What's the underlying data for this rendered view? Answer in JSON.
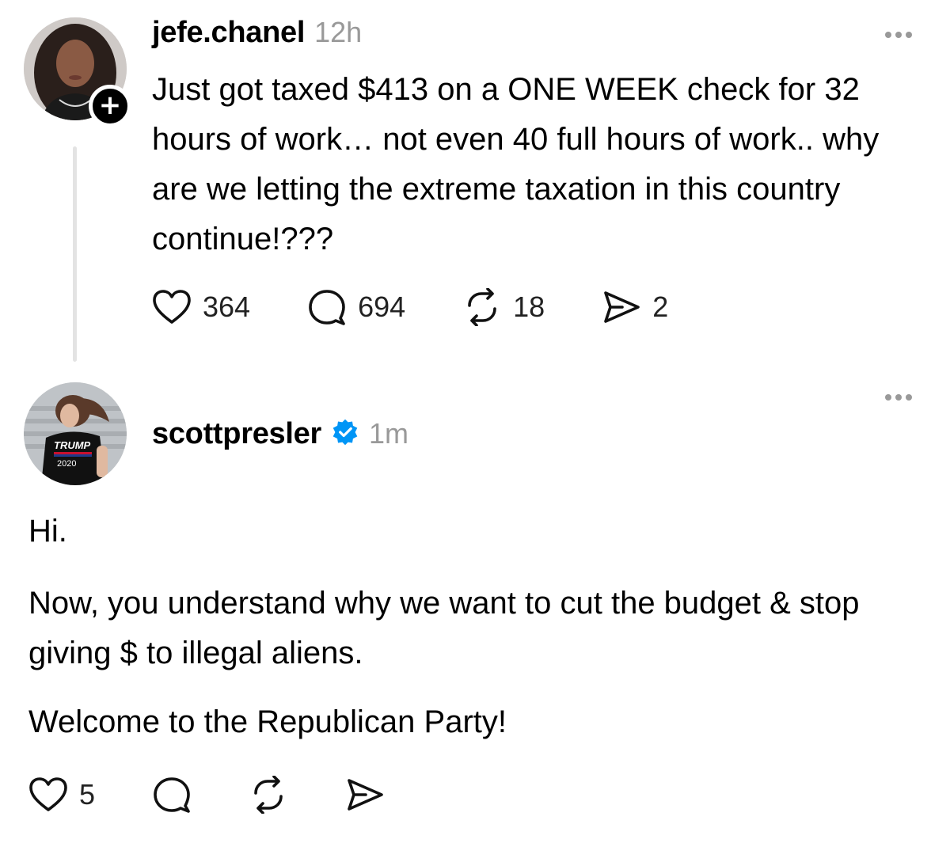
{
  "post1": {
    "username": "jefe.chanel",
    "timestamp": "12h",
    "follow_symbol": "+",
    "text": "Just got taxed $413 on a ONE WEEK check for 32 hours of work… not even 40 full hours of work.. why are we letting the extreme taxation in this country continue!???",
    "likes": "364",
    "comments": "694",
    "reposts": "18",
    "shares": "2"
  },
  "post2": {
    "username": "scottpresler",
    "timestamp": "1m",
    "avatar_shirt_line1": "TRUMP",
    "avatar_shirt_line2": "2020",
    "paragraphs": [
      "Hi.",
      "Now, you understand why we want to cut the budget & stop giving $ to illegal aliens.",
      "Welcome to the Republican Party!"
    ],
    "likes": "5"
  },
  "icons": {
    "heart": "heart-icon",
    "comment": "comment-icon",
    "repost": "repost-icon",
    "share": "send-icon",
    "more": "more-icon",
    "verified": "verified-badge-icon"
  },
  "colors": {
    "verified": "#0095f6",
    "muted": "#999999",
    "thread_line": "#e3e3e3"
  }
}
